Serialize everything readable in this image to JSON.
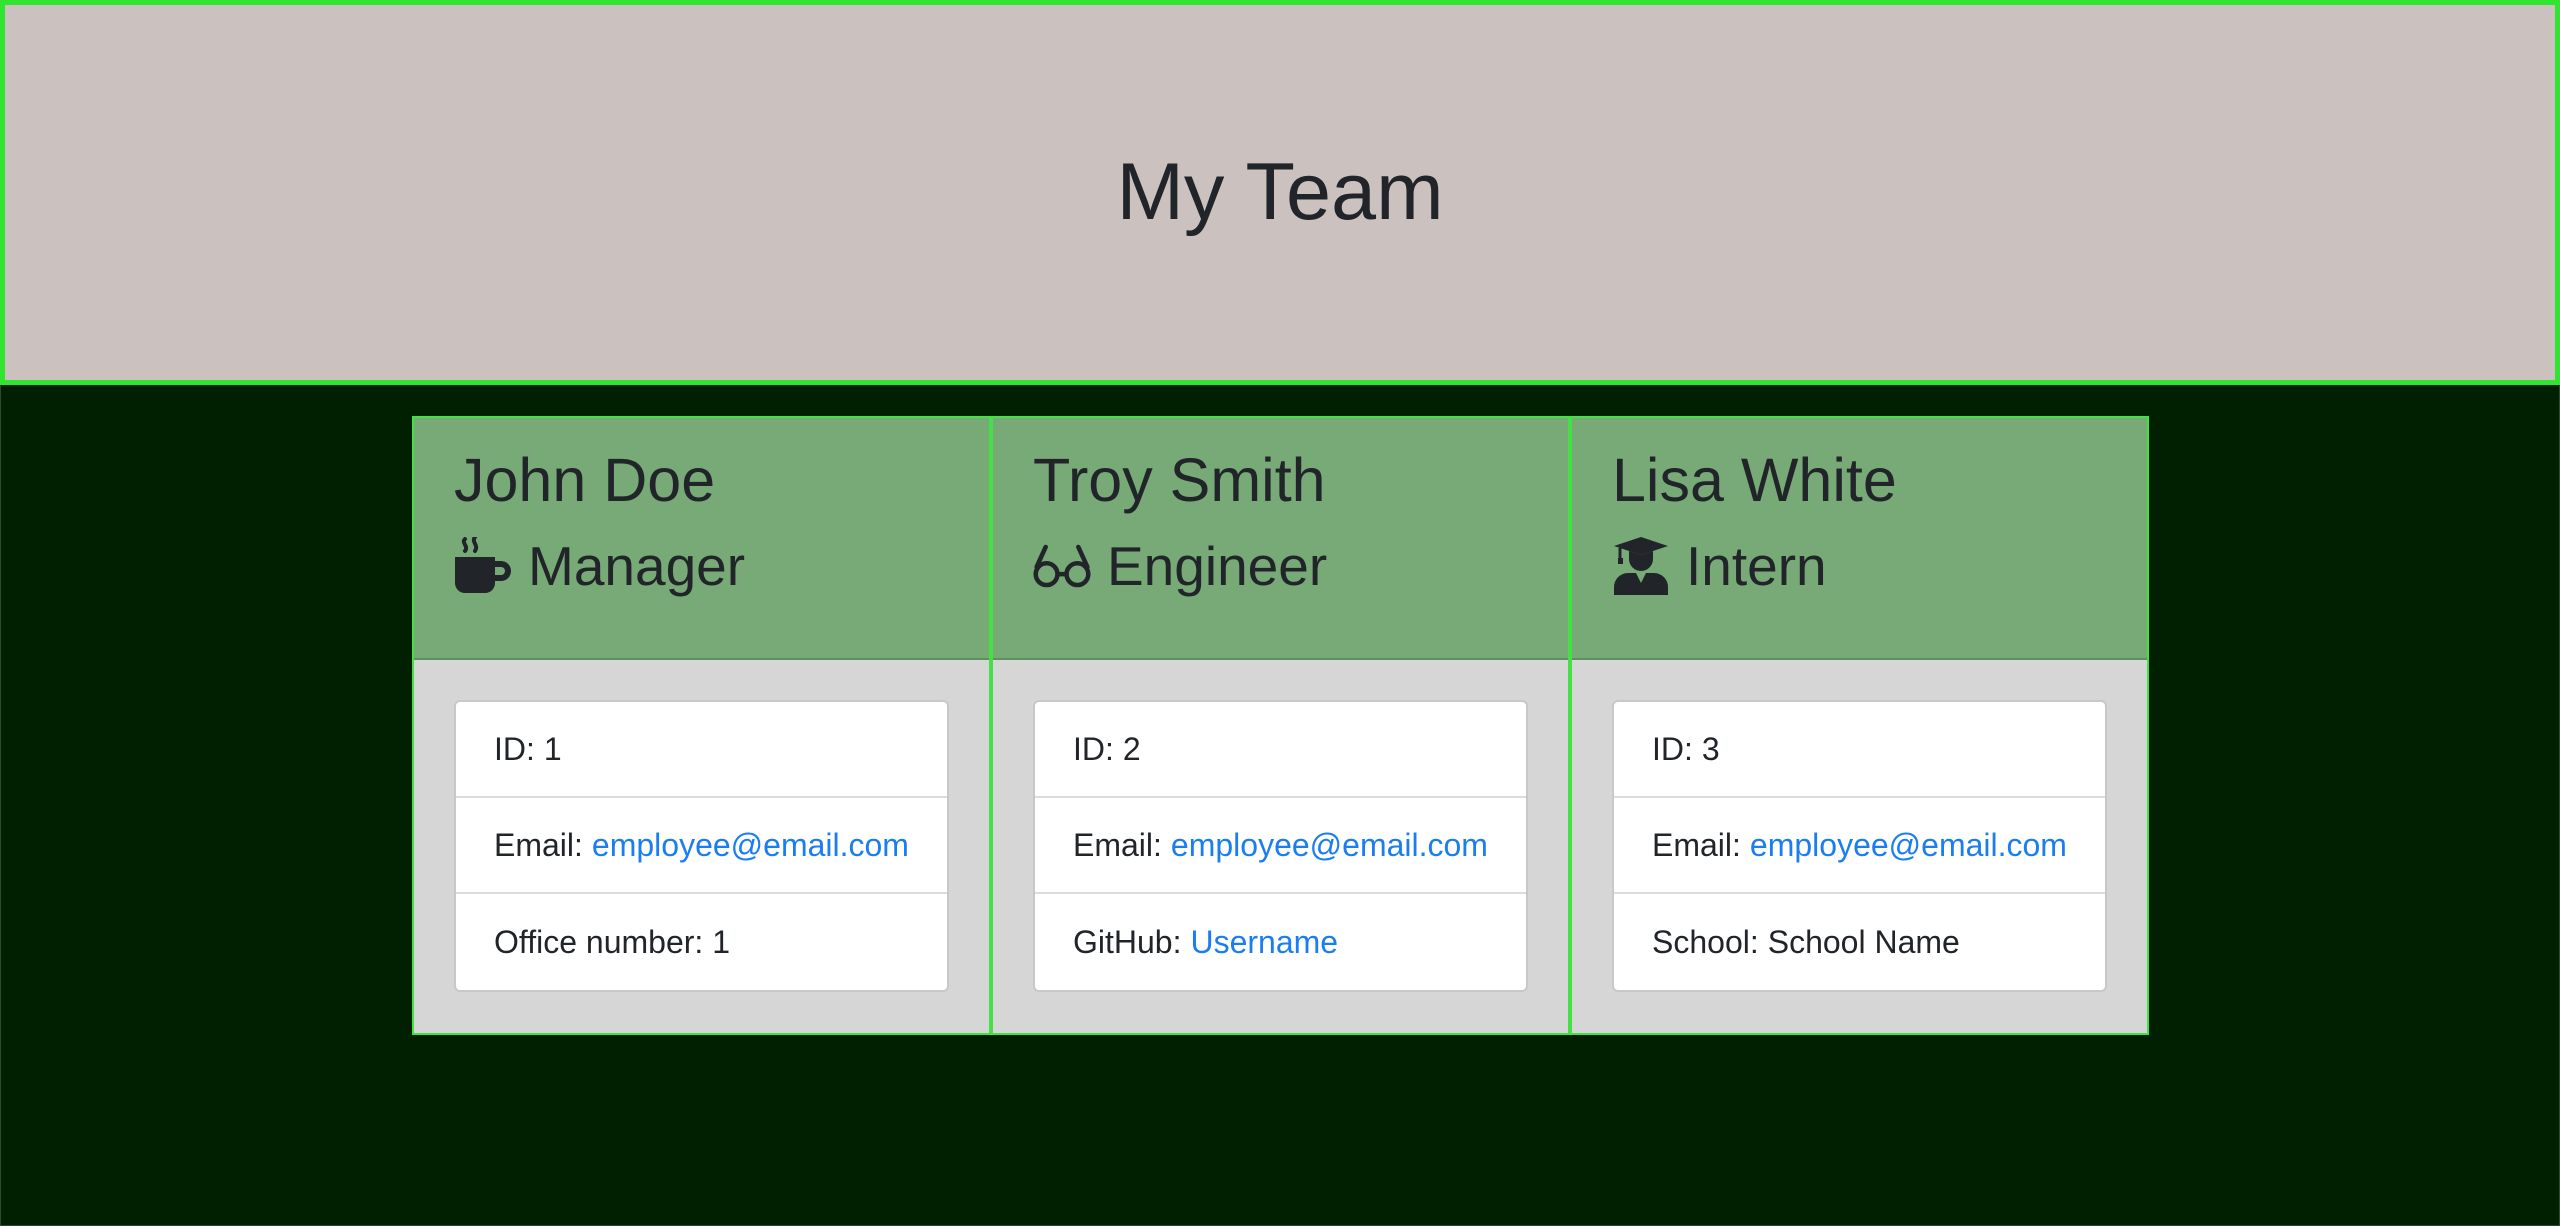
{
  "header": {
    "title": "My Team",
    "background": "#cbc1bf",
    "border_color": "#2fe52f"
  },
  "page": {
    "background": "#012001"
  },
  "employees": [
    {
      "name": "John Doe",
      "role": "Manager",
      "icon": "mug-hot-icon",
      "id_label": "ID:",
      "id": "1",
      "email_label": "Email:",
      "email": "employee@email.com",
      "extra_label": "Office number:",
      "extra_value": "1"
    },
    {
      "name": "Troy Smith",
      "role": "Engineer",
      "icon": "glasses-icon",
      "id_label": "ID:",
      "id": "2",
      "email_label": "Email:",
      "email": "employee@email.com",
      "extra_label": "GitHub:",
      "extra_value": "Username"
    },
    {
      "name": "Lisa White",
      "role": "Intern",
      "icon": "user-graduate-icon",
      "id_label": "ID:",
      "id": "3",
      "email_label": "Email:",
      "email": "employee@email.com",
      "extra_label": "School:",
      "extra_value": "School Name"
    }
  ],
  "colors": {
    "card_header": "#77aa77",
    "card_border": "#45e045",
    "card_body": "#d6d6d6",
    "link": "#1b7ef0"
  }
}
